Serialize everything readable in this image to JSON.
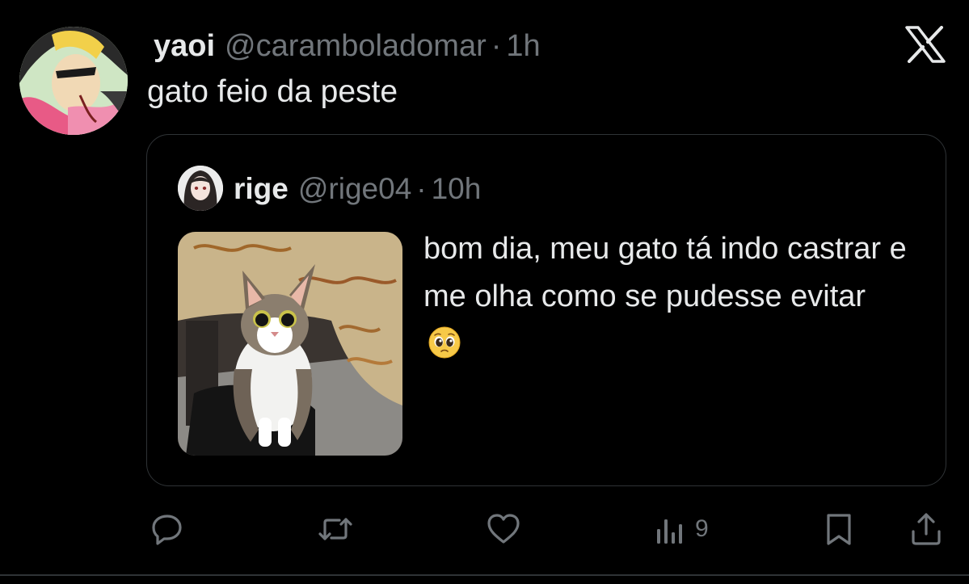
{
  "tweet": {
    "display_name": "yaoi",
    "handle": "@caramboladomar",
    "separator": "·",
    "time": "1h",
    "text": "gato feio da peste"
  },
  "quoted_tweet": {
    "display_name": "rige",
    "handle": "@rige04",
    "separator": "·",
    "time": "10h",
    "text": "bom dia, meu gato tá indo castrar e me olha como se pudesse evitar",
    "emoji": "pleading-face"
  },
  "actions": {
    "views_count": "9"
  },
  "colors": {
    "background": "#000000",
    "primary_text": "#e7e9ea",
    "secondary_text": "#71767b",
    "border": "#2f3336"
  },
  "icons": [
    "x-logo-icon",
    "reply-icon",
    "retweet-icon",
    "like-icon",
    "views-icon",
    "bookmark-icon",
    "share-icon"
  ]
}
